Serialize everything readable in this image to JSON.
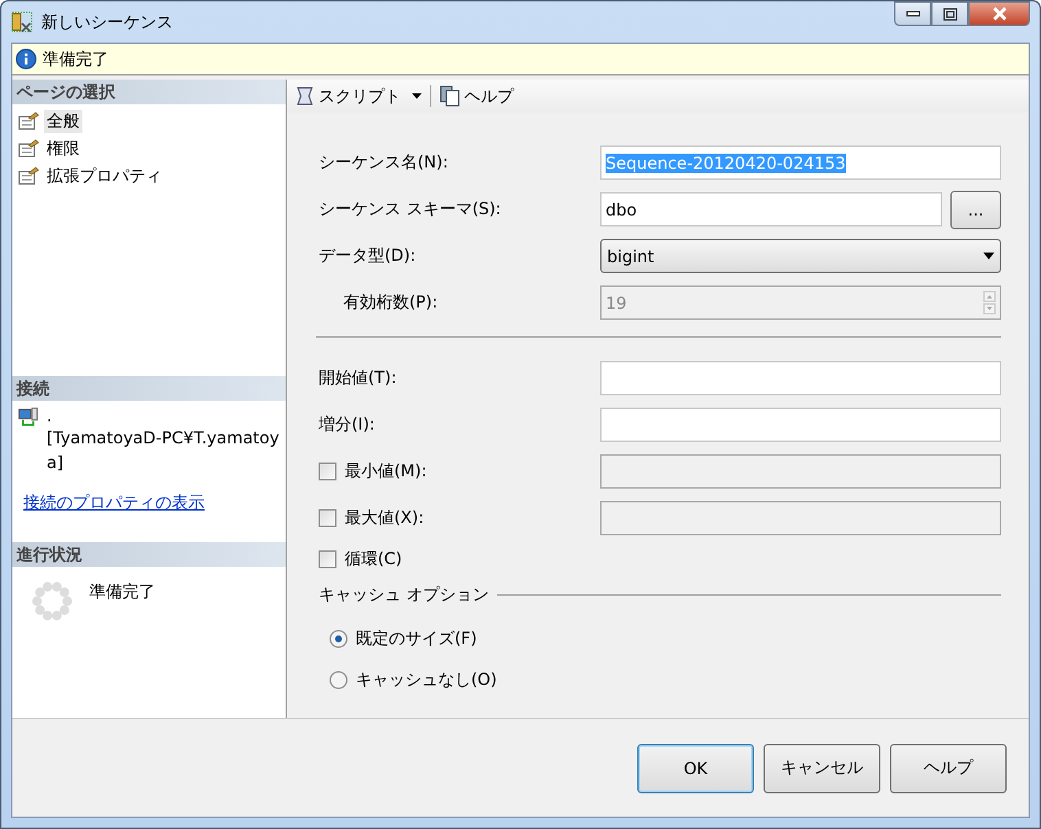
{
  "window": {
    "title": "新しいシーケンス"
  },
  "status_message": "準備完了",
  "sidebar": {
    "pages_header": "ページの選択",
    "pages": [
      {
        "label": "全般",
        "selected": true
      },
      {
        "label": "権限",
        "selected": false
      },
      {
        "label": "拡張プロパティ",
        "selected": false
      }
    ],
    "connection_header": "接続",
    "server": ".",
    "user": "[TyamatoyaD-PC¥T.yamatoya]",
    "connection_link": "接続のプロパティの表示",
    "progress_header": "進行状況",
    "progress_status": "準備完了"
  },
  "toolbar": [
    {
      "label": "スクリプト",
      "kind": "dropdown"
    },
    {
      "label": "ヘルプ",
      "kind": "button"
    }
  ],
  "fields": [
    {
      "kind": "text",
      "label": "シーケンス名(N):",
      "value": "Sequence-20120420-024153",
      "highlighted": true
    },
    {
      "kind": "browse",
      "label": "シーケンス スキーマ(S):",
      "value": "dbo",
      "button": "..."
    },
    {
      "kind": "dropdown",
      "label": "データ型(D):",
      "value": "bigint"
    },
    {
      "kind": "spinner",
      "label": "有効桁数(P):",
      "value": "19",
      "disabled": true
    },
    {
      "kind": "separator"
    },
    {
      "kind": "text",
      "label": "開始値(T):"
    },
    {
      "kind": "text",
      "label": "増分(I):"
    },
    {
      "kind": "checkfield",
      "label": "最小値(M):",
      "checked": false
    },
    {
      "kind": "checkfield",
      "label": "最大値(X):",
      "checked": false
    },
    {
      "kind": "checkbox",
      "label": "循環(C)",
      "checked": false
    }
  ],
  "cache_options": {
    "title": "キャッシュ オプション",
    "options": [
      {
        "label": "既定のサイズ(F)",
        "selected": true
      },
      {
        "label": "キャッシュなし(O)",
        "selected": false
      }
    ]
  },
  "buttons": [
    {
      "label": "OK",
      "default": true
    },
    {
      "label": "キャンセル",
      "default": false
    },
    {
      "label": "ヘルプ",
      "default": false
    }
  ]
}
